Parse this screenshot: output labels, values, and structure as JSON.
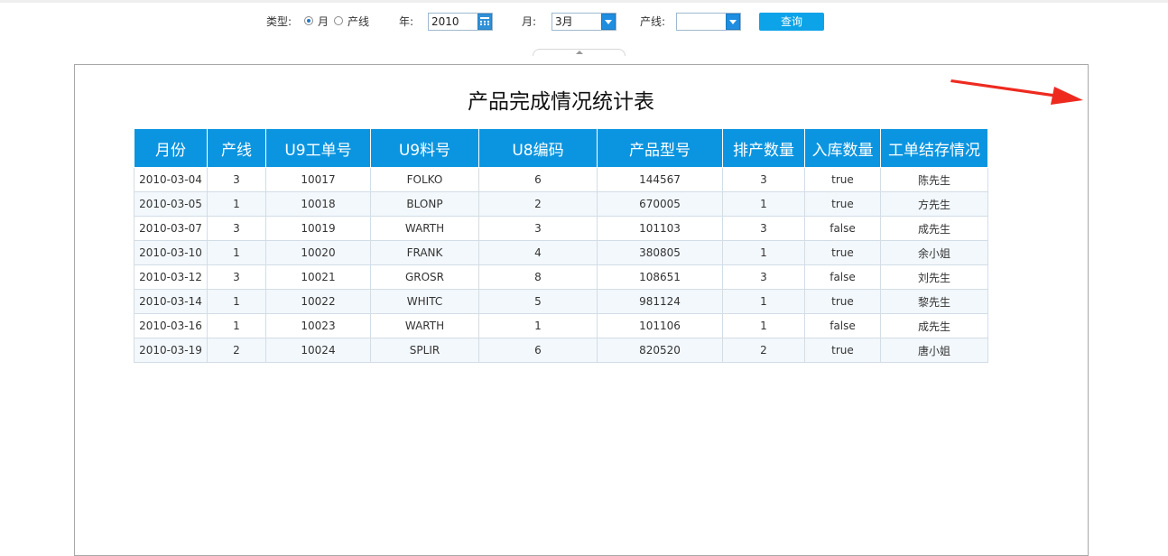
{
  "toolbar": {
    "type_label": "类型:",
    "radio_month_label": "月",
    "radio_line_label": "产线",
    "year_label": "年:",
    "year_value": "2010",
    "month_label": "月:",
    "month_value": "3月",
    "line_label": "产线:",
    "line_value": "",
    "query_label": "查询",
    "selected_type": "月"
  },
  "report": {
    "title": "产品完成情况统计表",
    "columns": [
      "月份",
      "产线",
      "U9工单号",
      "U9料号",
      "U8编码",
      "产品型号",
      "排产数量",
      "入库数量",
      "工单结存情况"
    ],
    "rows": [
      [
        "2010-03-04",
        "3",
        "10017",
        "FOLKO",
        "6",
        "144567",
        "3",
        "true",
        "陈先生"
      ],
      [
        "2010-03-05",
        "1",
        "10018",
        "BLONP",
        "2",
        "670005",
        "1",
        "true",
        "方先生"
      ],
      [
        "2010-03-07",
        "3",
        "10019",
        "WARTH",
        "3",
        "101103",
        "3",
        "false",
        "成先生"
      ],
      [
        "2010-03-10",
        "1",
        "10020",
        "FRANK",
        "4",
        "380805",
        "1",
        "true",
        "余小姐"
      ],
      [
        "2010-03-12",
        "3",
        "10021",
        "GROSR",
        "8",
        "108651",
        "3",
        "false",
        "刘先生"
      ],
      [
        "2010-03-14",
        "1",
        "10022",
        "WHITC",
        "5",
        "981124",
        "1",
        "true",
        "黎先生"
      ],
      [
        "2010-03-16",
        "1",
        "10023",
        "WARTH",
        "1",
        "101106",
        "1",
        "false",
        "成先生"
      ],
      [
        "2010-03-19",
        "2",
        "10024",
        "SPLIR",
        "6",
        "820520",
        "2",
        "true",
        "唐小姐"
      ]
    ]
  },
  "colors": {
    "header_bg": "#0b95e0",
    "query_button": "#0ca3e8",
    "annotation_arrow": "#ee2a1f"
  }
}
